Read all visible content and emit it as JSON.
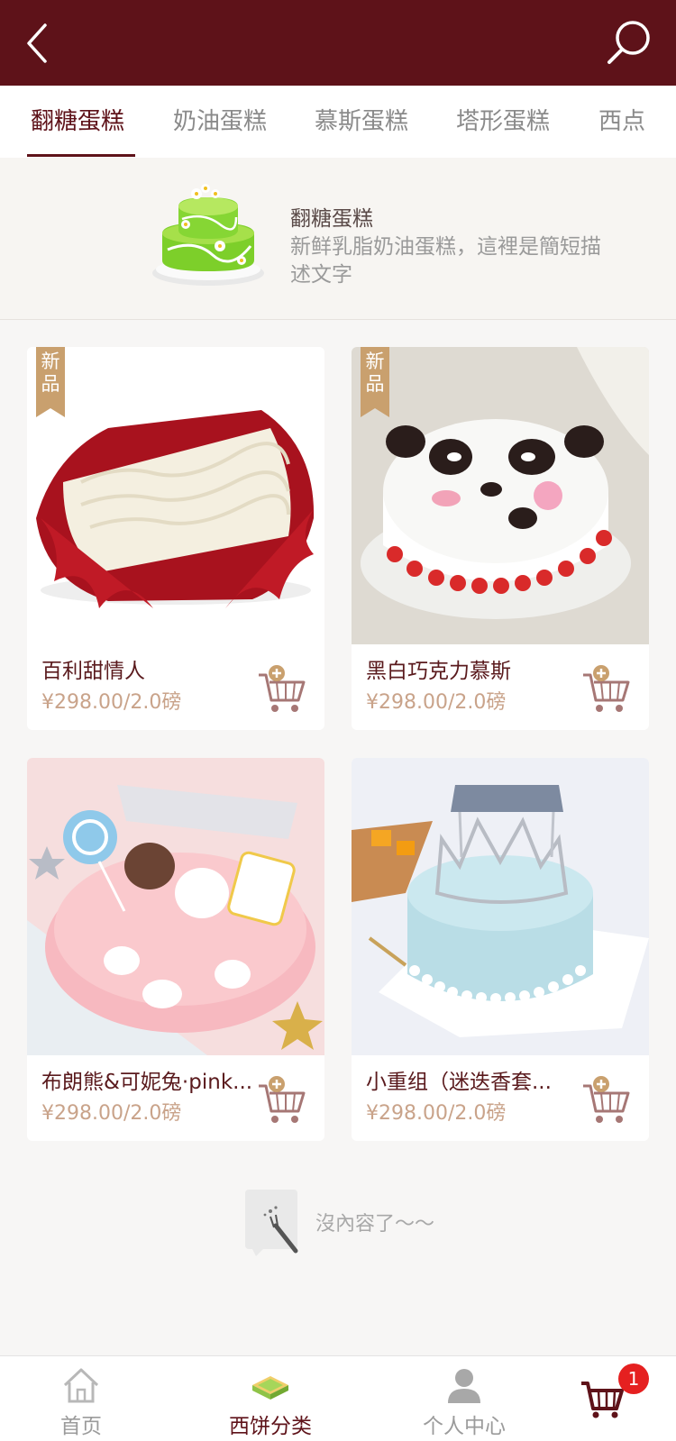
{
  "header": {
    "back_icon": "chevron-left-icon",
    "search_icon": "search-icon",
    "background": "#5e1219"
  },
  "tabs": [
    {
      "label": "翻糖蛋糕",
      "active": true
    },
    {
      "label": "奶油蛋糕",
      "active": false
    },
    {
      "label": "慕斯蛋糕",
      "active": false
    },
    {
      "label": "塔形蛋糕",
      "active": false
    },
    {
      "label": "西点",
      "active": false
    }
  ],
  "category": {
    "title": "翻糖蛋糕",
    "description": "新鲜乳脂奶油蛋糕，這裡是簡短描述文字",
    "image": "green-layer-cake-image"
  },
  "products": [
    {
      "name": "百利甜情人",
      "price": "¥298.00/2.0磅",
      "tag": "新品",
      "image": "rose-petal-cream-cake-image"
    },
    {
      "name": "黑白巧克力慕斯",
      "price": "¥298.00/2.0磅",
      "tag": "新品",
      "image": "panda-cake-image"
    },
    {
      "name": "布朗熊&可妮兔·pink...",
      "price": "¥298.00/2.0磅",
      "tag": "",
      "image": "pink-birthday-cake-image"
    },
    {
      "name": "小重组（迷迭香套...",
      "price": "¥298.00/2.0磅",
      "tag": "",
      "image": "blue-crown-birthday-cake-image"
    }
  ],
  "end_note": "沒內容了～～",
  "tabbar": {
    "items": [
      {
        "label": "首页",
        "icon": "home-icon",
        "active": false
      },
      {
        "label": "西饼分类",
        "icon": "cake-slice-icon",
        "active": true
      },
      {
        "label": "个人中心",
        "icon": "user-icon",
        "active": false
      },
      {
        "label": "",
        "icon": "cart-icon",
        "active": false
      }
    ],
    "cart_badge": "1"
  },
  "colors": {
    "brand": "#5e1219",
    "price": "#c9a38a",
    "new_tag": "#c9a06e",
    "badge": "#e52020"
  }
}
